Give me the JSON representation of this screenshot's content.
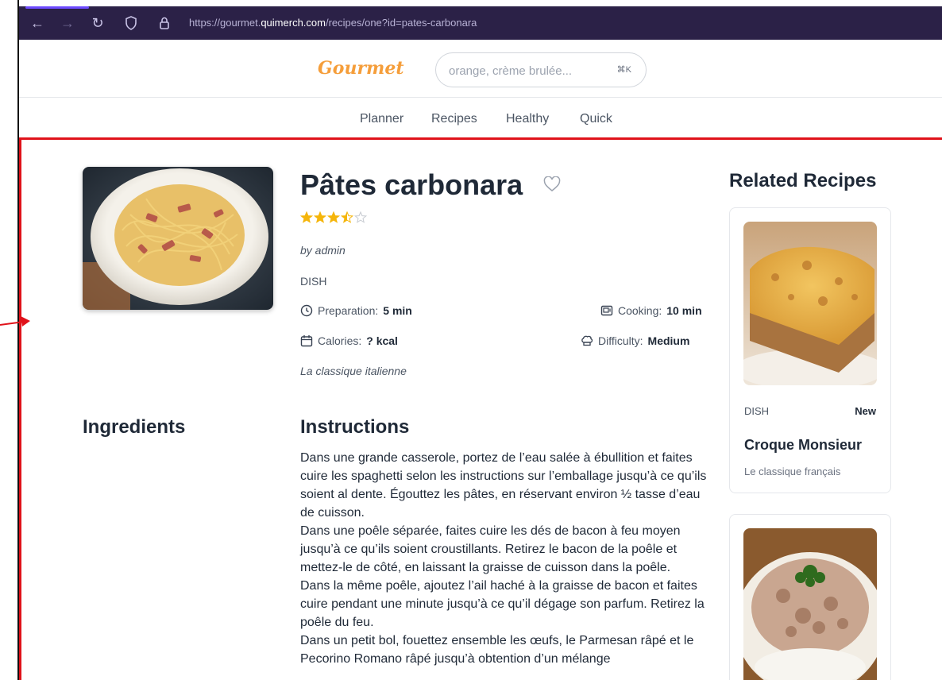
{
  "browser": {
    "url_prefix": "https://gourmet.",
    "url_host": "quimerch.com",
    "url_path": "/recipes/one?id=pates-carbonara"
  },
  "header": {
    "logo": "Gourmet",
    "search_placeholder": "orange, crème brulée...",
    "search_shortcut": "⌘K"
  },
  "nav": {
    "items": [
      "Planner",
      "Recipes",
      "Healthy",
      "Quick"
    ]
  },
  "recipe": {
    "title": "Pâtes carbonara",
    "rating": 3.5,
    "rating_max": 5,
    "author": "by admin",
    "category": "DISH",
    "prep_label": "Preparation:",
    "prep_value": "5 min",
    "cook_label": "Cooking:",
    "cook_value": "10 min",
    "calories_label": "Calories:",
    "calories_value": "? kcal",
    "difficulty_label": "Difficulty:",
    "difficulty_value": "Medium",
    "subtitle": "La classique italienne",
    "ingredients_heading": "Ingredients",
    "instructions_heading": "Instructions",
    "instructions": [
      "Dans une grande casserole, portez de l’eau salée à ébullition et faites cuire les spaghetti selon les instructions sur l’emballage jusqu’à ce qu’ils soient al dente. Égouttez les pâtes, en réservant environ ½ tasse d’eau de cuisson.",
      "Dans une poêle séparée, faites cuire les dés de bacon à feu moyen jusqu’à ce qu’ils soient croustillants. Retirez le bacon de la poêle et mettez-le de côté, en laissant la graisse de cuisson dans la poêle.",
      "Dans la même poêle, ajoutez l’ail haché à la graisse de bacon et faites cuire pendant une minute jusqu’à ce qu’il dégage son parfum. Retirez la poêle du feu.",
      "Dans un petit bol, fouettez ensemble les œufs, le Parmesan râpé et le Pecorino Romano râpé jusqu’à obtention d’un mélange"
    ]
  },
  "related": {
    "heading": "Related Recipes",
    "cards": [
      {
        "category": "DISH",
        "badge": "New",
        "name": "Croque Monsieur",
        "description": "Le classique français"
      },
      {
        "category": "",
        "badge": "",
        "name": "",
        "description": ""
      }
    ]
  }
}
